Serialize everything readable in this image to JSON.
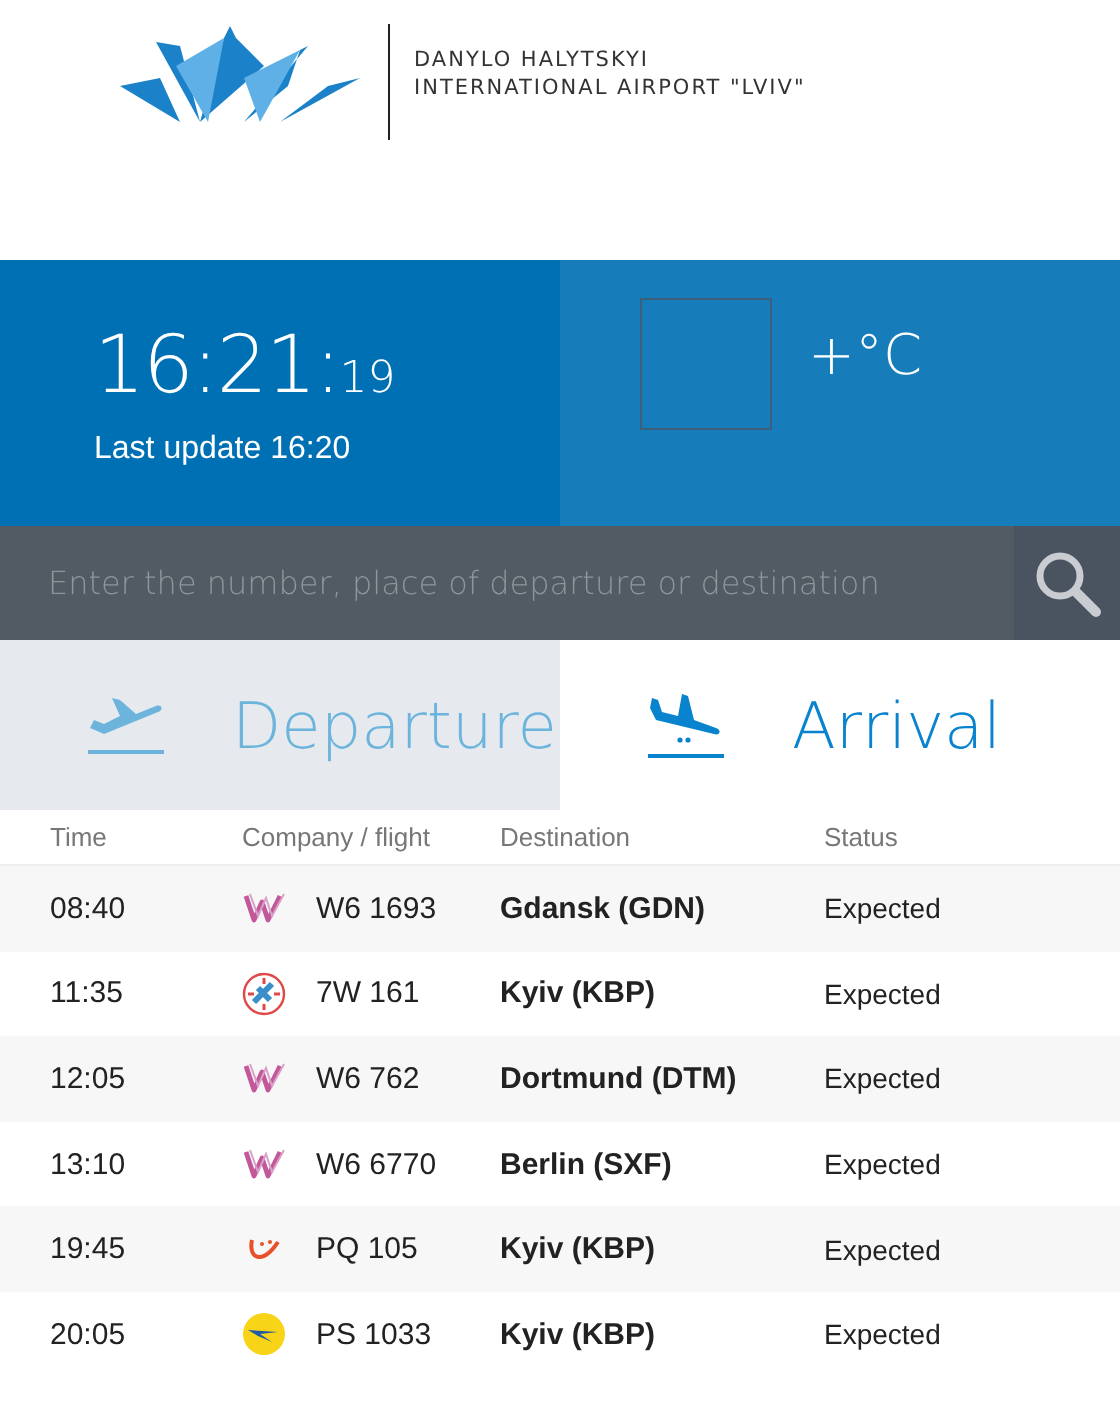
{
  "airport": {
    "name_line_1": "DANYLO HALYTSKYI",
    "name_line_2": "INTERNATIONAL AIRPORT \"LVIV\""
  },
  "clock": {
    "hours_minutes": "16:21:",
    "seconds": "19",
    "last_update": "Last update 16:20"
  },
  "weather": {
    "temperature": "+°C"
  },
  "search": {
    "placeholder": "Enter the number, place of departure or destination"
  },
  "tabs": [
    {
      "label": "Departure",
      "kind": "departure",
      "selected": false
    },
    {
      "label": "Arrival",
      "kind": "arrival",
      "selected": true
    }
  ],
  "table": {
    "columns": [
      "Time",
      "Company / flight",
      "Destination",
      "Status"
    ],
    "rows": [
      {
        "time": "08:40",
        "kind": "w",
        "flight": "W6 1693",
        "destination": "Gdansk (GDN)",
        "status": "Expected"
      },
      {
        "time": "11:35",
        "kind": "star",
        "flight": "7W 161",
        "destination": "Kyiv (KBP)",
        "status": "Expected"
      },
      {
        "time": "12:05",
        "kind": "w",
        "flight": "W6 762",
        "destination": "Dortmund (DTM)",
        "status": "Expected"
      },
      {
        "time": "13:10",
        "kind": "w",
        "flight": "W6 6770",
        "destination": "Berlin (SXF)",
        "status": "Expected"
      },
      {
        "time": "19:45",
        "kind": "smile",
        "flight": "PQ 105",
        "destination": "Kyiv (KBP)",
        "status": "Expected"
      },
      {
        "time": "20:05",
        "kind": "disc",
        "flight": "PS 1033",
        "destination": "Kyiv (KBP)",
        "status": "Expected"
      }
    ]
  }
}
